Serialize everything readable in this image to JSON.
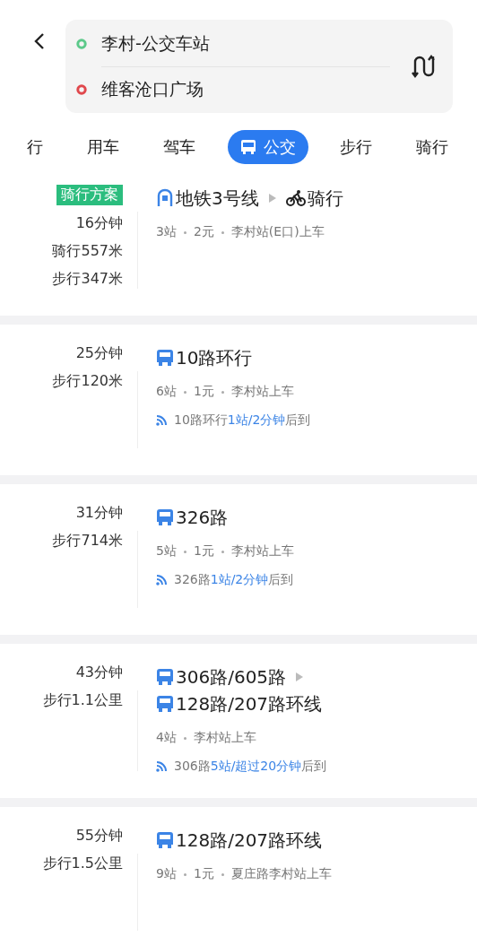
{
  "header": {
    "origin": "李村-公交车站",
    "destination": "维客沧口广场"
  },
  "tabs": [
    {
      "label": "行",
      "selected": false
    },
    {
      "label": "用车",
      "selected": false
    },
    {
      "label": "驾车",
      "selected": false
    },
    {
      "label": "公交",
      "selected": true
    },
    {
      "label": "步行",
      "selected": false
    },
    {
      "label": "骑行",
      "selected": false
    }
  ],
  "routes": [
    {
      "badge": "骑行方案",
      "time": "16分钟",
      "distances": [
        "骑行557米",
        "步行347米"
      ],
      "segments": [
        {
          "kind": "subway",
          "name": "地铁3号线"
        },
        {
          "kind": "bike",
          "name": "骑行"
        }
      ],
      "info": [
        "3站",
        "2元",
        "李村站(E口)上车"
      ]
    },
    {
      "time": "25分钟",
      "distances": [
        "步行120米"
      ],
      "segments": [
        {
          "kind": "bus",
          "name": "10路环行"
        }
      ],
      "info": [
        "6站",
        "1元",
        "李村站上车"
      ],
      "realtime": {
        "line": "10路环行",
        "eta": "1站/2分钟",
        "suffix": "后到"
      }
    },
    {
      "time": "31分钟",
      "distances": [
        "步行714米"
      ],
      "segments": [
        {
          "kind": "bus",
          "name": "326路"
        }
      ],
      "info": [
        "5站",
        "1元",
        "李村站上车"
      ],
      "realtime": {
        "line": "326路",
        "eta": "1站/2分钟",
        "suffix": "后到"
      }
    },
    {
      "time": "43分钟",
      "distances": [
        "步行1.1公里"
      ],
      "segments": [
        {
          "kind": "bus",
          "name": "306路/605路"
        },
        {
          "kind": "bus",
          "name": "128路/207路环线"
        }
      ],
      "info": [
        "4站",
        "李村站上车"
      ],
      "realtime": {
        "line": "306路",
        "eta": "5站/超过20分钟",
        "suffix": "后到"
      }
    },
    {
      "time": "55分钟",
      "distances": [
        "步行1.5公里"
      ],
      "segments": [
        {
          "kind": "bus",
          "name": "128路/207路环线"
        }
      ],
      "info": [
        "9站",
        "1元",
        "夏庄路李村站上车"
      ]
    }
  ]
}
